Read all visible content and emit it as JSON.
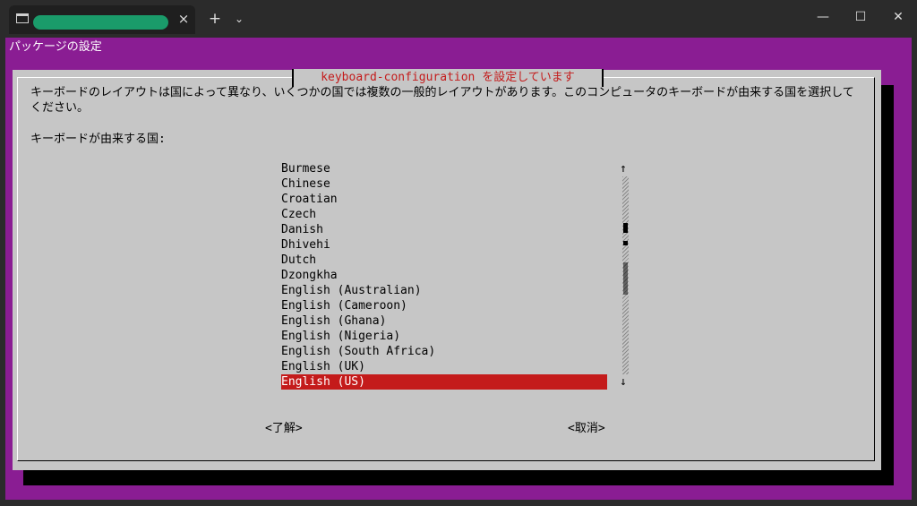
{
  "window": {
    "tab_icon": "terminal-icon",
    "close_tab": "×",
    "new_tab": "+",
    "tab_menu": "⌄",
    "minimize": "—",
    "maximize": "☐",
    "close": "✕"
  },
  "terminal": {
    "header": "パッケージの設定",
    "dialog": {
      "title": "keyboard-configuration を設定しています",
      "description": "キーボードのレイアウトは国によって異なり、いくつかの国では複数の一般的レイアウトがあります。このコンピュータのキーボードが由来する国を選択してください。",
      "prompt": "キーボードが由来する国:",
      "items": [
        "Burmese",
        "Chinese",
        "Croatian",
        "Czech",
        "Danish",
        "Dhivehi",
        "Dutch",
        "Dzongkha",
        "English (Australian)",
        "English (Cameroon)",
        "English (Ghana)",
        "English (Nigeria)",
        "English (South Africa)",
        "English (UK)",
        "English (US)"
      ],
      "selected": "English (US)",
      "scroll_up": "↑",
      "scroll_down": "↓",
      "ok": "<了解>",
      "cancel": "<取消>"
    }
  },
  "colors": {
    "background": "#8a1d93",
    "dialog": "#c6c6c6",
    "accent": "#c41b1b",
    "tab_title": "#1a9b6a"
  }
}
